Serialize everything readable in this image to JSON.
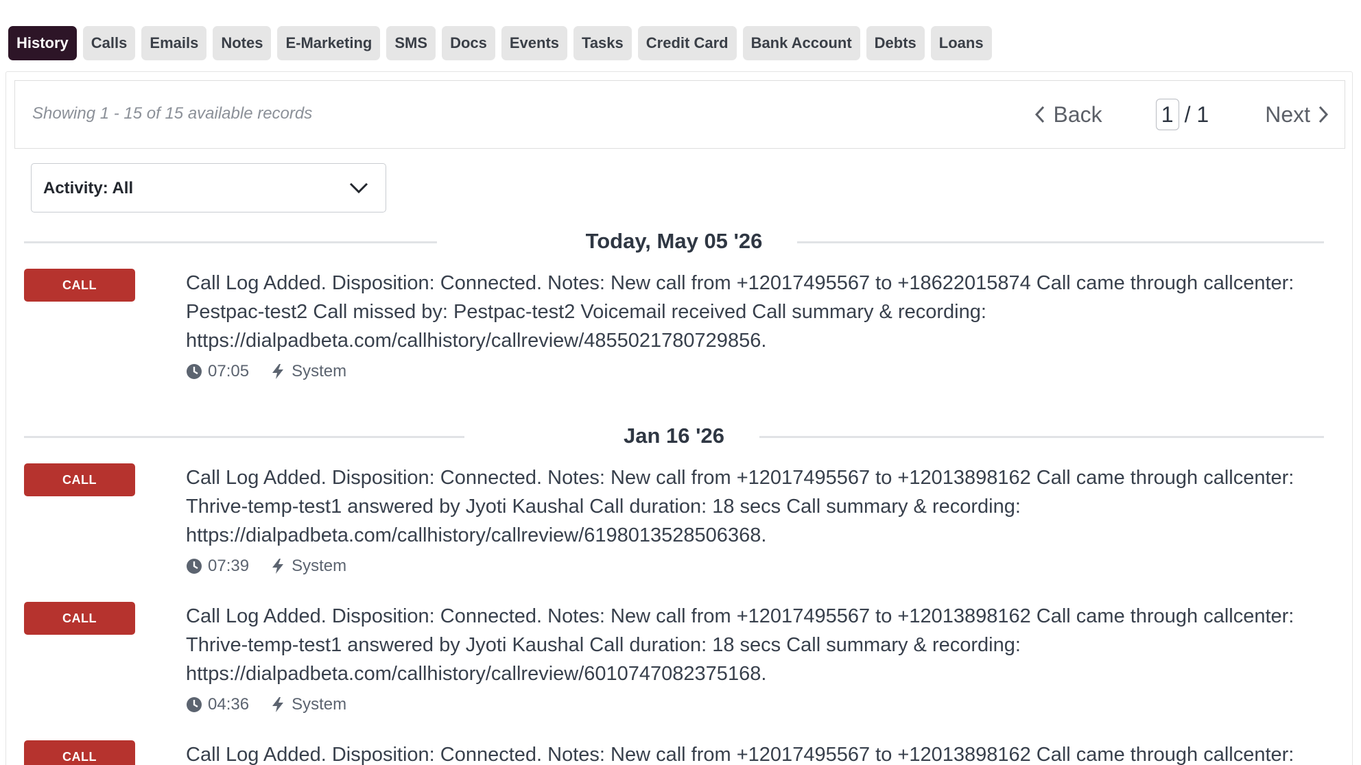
{
  "tabs": [
    "History",
    "Calls",
    "Emails",
    "Notes",
    "E-Marketing",
    "SMS",
    "Docs",
    "Events",
    "Tasks",
    "Credit Card",
    "Bank Account",
    "Debts",
    "Loans"
  ],
  "active_tab": "History",
  "pager": {
    "showing": "Showing 1 - 15 of 15 available records",
    "back_label": "Back",
    "next_label": "Next",
    "current_page": "1",
    "total_pages": "/ 1"
  },
  "filter": {
    "label": "Activity: All"
  },
  "groups": [
    {
      "date": "Today, May 05 '26",
      "entries": [
        {
          "badge": "CALL",
          "text": "Call Log Added. Disposition: Connected. Notes: New call from +12017495567 to +18622015874 Call came through callcenter: Pestpac-test2 Call missed by: Pestpac-test2 Voicemail received Call summary & recording: https://dialpadbeta.com/callhistory/callreview/4855021780729856.",
          "time": "07:05",
          "author": "System"
        }
      ]
    },
    {
      "date": "Jan 16 '26",
      "entries": [
        {
          "badge": "CALL",
          "text": "Call Log Added. Disposition: Connected. Notes: New call from +12017495567 to +12013898162 Call came through callcenter: Thrive-temp-test1 answered by Jyoti Kaushal Call duration: 18 secs Call summary & recording: https://dialpadbeta.com/callhistory/callreview/6198013528506368.",
          "time": "07:39",
          "author": "System"
        },
        {
          "badge": "CALL",
          "text": "Call Log Added. Disposition: Connected. Notes: New call from +12017495567 to +12013898162 Call came through callcenter: Thrive-temp-test1 answered by Jyoti Kaushal Call duration: 18 secs Call summary & recording: https://dialpadbeta.com/callhistory/callreview/6010747082375168.",
          "time": "04:36",
          "author": "System"
        },
        {
          "badge": "CALL",
          "text": "Call Log Added. Disposition: Connected. Notes: New call from +12017495567 to +12013898162 Call came through callcenter:",
          "time": "",
          "author": ""
        }
      ]
    }
  ],
  "colors": {
    "active_tab": "#2d1527",
    "tab_bg": "#e6e6e6",
    "call_badge": "#b6332e"
  },
  "icons": {
    "back": "chevron-left-icon",
    "next": "chevron-right-icon",
    "dropdown": "chevron-down-icon",
    "time": "clock-icon",
    "author": "bolt-icon"
  }
}
